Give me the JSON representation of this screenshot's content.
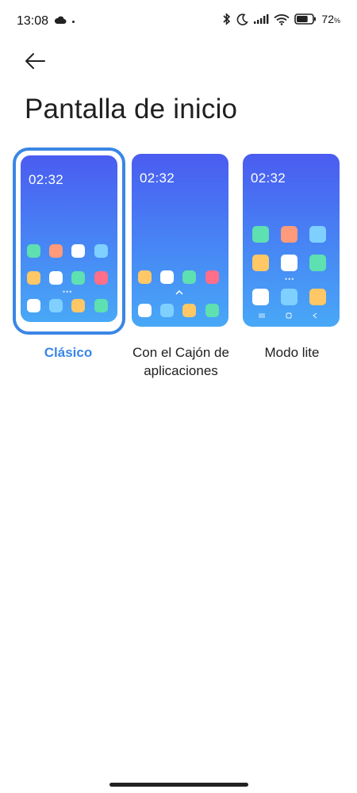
{
  "status_bar": {
    "time": "13:08",
    "battery_percent": "72",
    "battery_unit": "%",
    "battery_level": 0.72,
    "icons": [
      "cloud-icon",
      "bluetooth-icon",
      "moon-icon",
      "signal-icon",
      "wifi-icon",
      "battery-icon"
    ]
  },
  "header": {
    "back_icon": "arrow-left-icon",
    "title": "Pantalla de inicio"
  },
  "options": [
    {
      "label": "Clásico",
      "selected": true,
      "preview_clock": "02:32"
    },
    {
      "label": "Con el Cajón de aplicaciones",
      "selected": false,
      "preview_clock": "02:32"
    },
    {
      "label": "Modo lite",
      "selected": false,
      "preview_clock": "02:32"
    }
  ],
  "colors": {
    "accent": "#3a86e6",
    "preview_gradient_top": "#4a5cf0",
    "preview_gradient_bottom": "#48a8f6",
    "app_green": "#5ee0b0",
    "app_orange": "#ff9a7a",
    "app_white": "#ffffff",
    "app_lightblue": "#7fd0ff",
    "app_yellow": "#ffc766",
    "app_pink": "#ff6f8a"
  }
}
